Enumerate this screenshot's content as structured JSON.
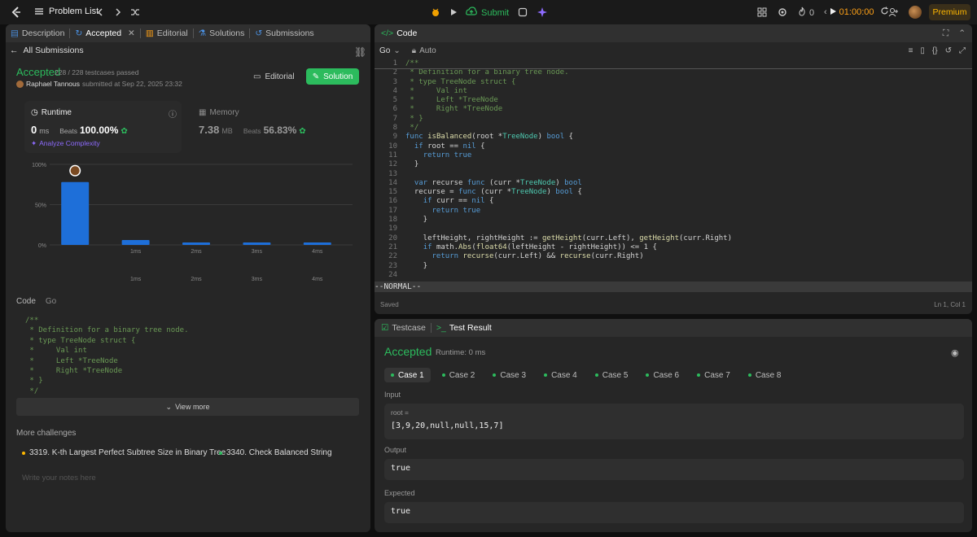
{
  "topbar": {
    "problem_list": "Problem List",
    "submit": "Submit",
    "streak": "0",
    "timer": "01:00:00",
    "premium": "Premium"
  },
  "left": {
    "tabs": [
      {
        "label": "Description"
      },
      {
        "label": "Accepted"
      },
      {
        "label": "Editorial"
      },
      {
        "label": "Solutions"
      },
      {
        "label": "Submissions"
      }
    ],
    "all_submissions": "All Submissions",
    "status": "Accepted",
    "testcases": "228 / 228 testcases passed",
    "author": "Raphael Tannous",
    "submitted_at": "submitted at Sep 22, 2025 23:32",
    "editorial_btn": "Editorial",
    "solution_btn": "Solution",
    "runtime": {
      "label": "Runtime",
      "value": "0",
      "unit": "ms",
      "beats_label": "Beats",
      "beats": "100.00%"
    },
    "memory": {
      "label": "Memory",
      "value": "7.38",
      "unit": "MB",
      "beats_label": "Beats",
      "beats": "56.83%"
    },
    "analyze": "Analyze Complexity",
    "code_label": "Code",
    "lang_label": "Go",
    "snippet": [
      "/**",
      " * Definition for a binary tree node.",
      " * type TreeNode struct {",
      " *     Val int",
      " *     Left *TreeNode",
      " *     Right *TreeNode",
      " * }",
      " */"
    ],
    "view_more": "View more",
    "more_challenges": "More challenges",
    "challenges": [
      {
        "label": "3319. K-th Largest Perfect Subtree Size in Binary Tree",
        "color": "#ffb800"
      },
      {
        "label": "3340. Check Balanced String",
        "color": "#2cbb5d"
      }
    ],
    "notes_placeholder": "Write your notes here"
  },
  "chart_data": {
    "type": "bar",
    "categories": [
      "0ms",
      "1ms",
      "2ms",
      "3ms",
      "4ms"
    ],
    "values": [
      78,
      6,
      3,
      3,
      3
    ],
    "yticks": [
      "100%",
      "50%",
      "0%"
    ],
    "xticks": [
      "1ms",
      "2ms",
      "3ms",
      "4ms"
    ],
    "xticks2": [
      "1ms",
      "2ms",
      "3ms",
      "4ms"
    ],
    "ylim": [
      0,
      100
    ],
    "highlight_index": 0,
    "bar_color": "#1e6fd9"
  },
  "editor": {
    "title": "Code",
    "lang": "Go",
    "mode": "Auto",
    "vim_mode": "--NORMAL--",
    "saved": "Saved",
    "cursor": "Ln 1, Col 1",
    "lines": [
      "/**",
      " * Definition for a binary tree node.",
      " * type TreeNode struct {",
      " *     Val int",
      " *     Left *TreeNode",
      " *     Right *TreeNode",
      " * }",
      " */",
      "func isBalanced(root *TreeNode) bool {",
      "  if root == nil {",
      "    return true",
      "  }",
      "",
      "  var recurse func (curr *TreeNode) bool",
      "  recurse = func (curr *TreeNode) bool {",
      "    if curr == nil {",
      "      return true",
      "    }",
      "",
      "    leftHeight, rightHeight := getHeight(curr.Left), getHeight(curr.Right)",
      "    if math.Abs(float64(leftHeight - rightHeight)) <= 1 {",
      "      return recurse(curr.Left) && recurse(curr.Right)",
      "    }",
      ""
    ]
  },
  "testpanel": {
    "tab_testcase": "Testcase",
    "tab_result": "Test Result",
    "status": "Accepted",
    "runtime": "Runtime: 0 ms",
    "cases": [
      "Case 1",
      "Case 2",
      "Case 3",
      "Case 4",
      "Case 5",
      "Case 6",
      "Case 7",
      "Case 8"
    ],
    "input_label": "Input",
    "param": "root =",
    "input_value": "[3,9,20,null,null,15,7]",
    "output_label": "Output",
    "output_value": "true",
    "expected_label": "Expected",
    "expected_value": "true"
  }
}
